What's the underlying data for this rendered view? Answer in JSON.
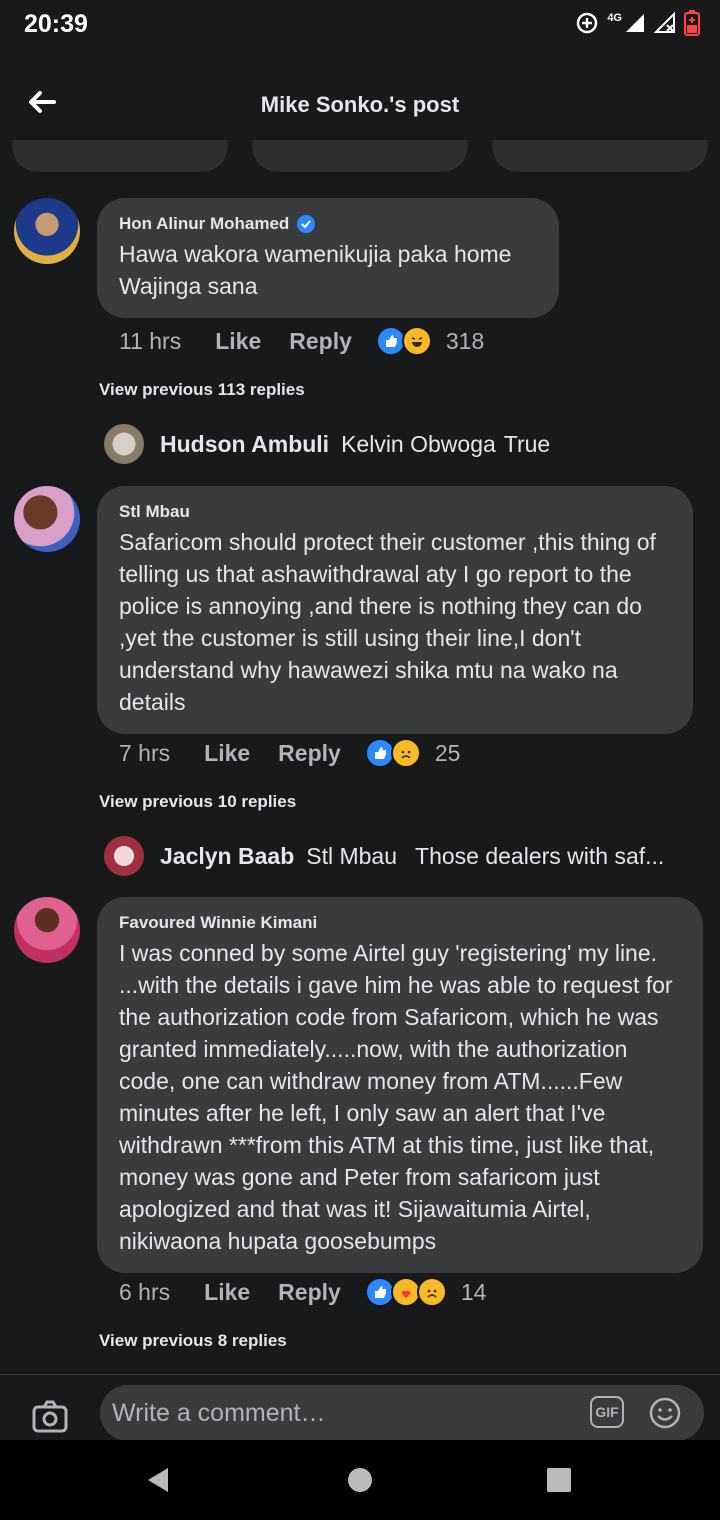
{
  "status": {
    "time": "20:39",
    "network": "4G"
  },
  "header": {
    "title": "Mike Sonko.'s post"
  },
  "comments": [
    {
      "author": "Hon Alinur Mohamed",
      "verified": true,
      "text": "Hawa wakora wamenikujia paka home Wajinga sana",
      "time": "11 hrs",
      "like": "Like",
      "reply": "Reply",
      "reaction_count": "318",
      "view_prev": "View previous 113 replies",
      "reply_preview": {
        "name": "Hudson Ambuli",
        "tag": "Kelvin Obwoga",
        "text": "True"
      }
    },
    {
      "author": "Stl Mbau",
      "verified": false,
      "text": "Safaricom should protect their customer ,this thing of telling us that ashawithdrawal aty I go report to the police is annoying ,and there is nothing they can do ,yet the customer is still using their line,I don't understand why hawawezi shika mtu na wako na details",
      "time": "7 hrs",
      "like": "Like",
      "reply": "Reply",
      "reaction_count": "25",
      "view_prev": "View previous 10 replies",
      "reply_preview": {
        "name": "Jaclyn Baab",
        "tag": "Stl Mbau",
        "text": "Those dealers with saf..."
      }
    },
    {
      "author": "Favoured Winnie Kimani",
      "verified": false,
      "text": "I was conned by some Airtel guy 'registering' my line. ...with the details i gave him he was able to request for the authorization code from Safaricom, which he was granted immediately.....now, with the authorization code, one can withdraw money from ATM......Few minutes after he left, I only saw an alert that I've withdrawn ***from this ATM at this time, just like that, money was gone and Peter from safaricom just apologized and that was it! Sijawaitumia Airtel, nikiwaona hupata goosebumps",
      "time": "6 hrs",
      "like": "Like",
      "reply": "Reply",
      "reaction_count": "14",
      "view_prev": "View previous 8 replies"
    }
  ],
  "composer": {
    "placeholder": "Write a comment…",
    "gif": "GIF"
  },
  "colors": {
    "like_blue": "#2d88ff",
    "haha_yellow": "#f7b928",
    "bg": "#18191a",
    "bubble": "#3a3b3c"
  }
}
